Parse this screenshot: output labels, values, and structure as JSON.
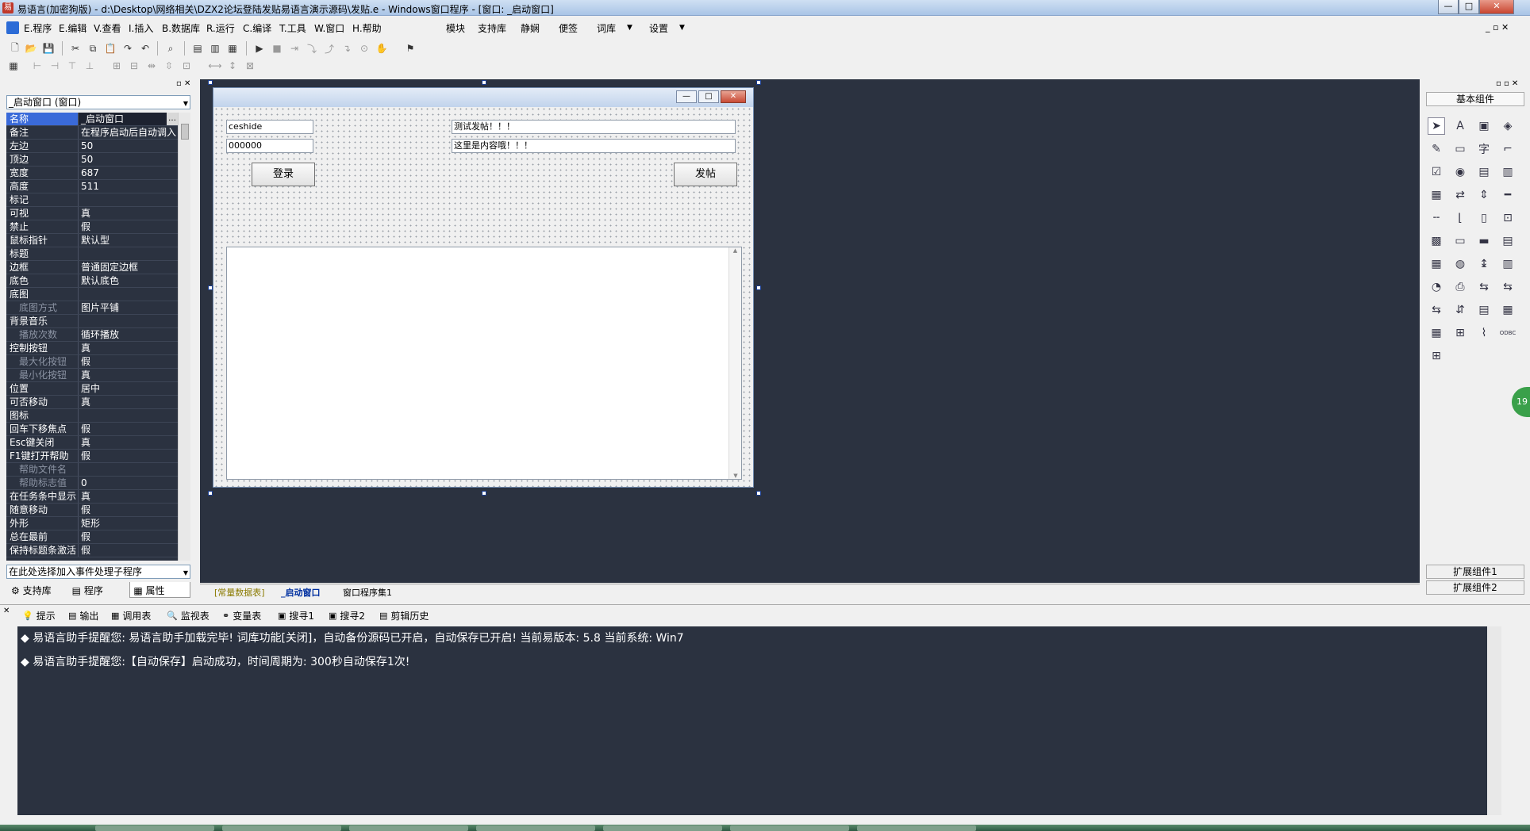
{
  "window": {
    "title": "易语言(加密狗版) - d:\\Desktop\\网络相关\\DZX2论坛登陆发贴易语言演示源码\\发贴.e - Windows窗口程序 - [窗口: _启动窗口]",
    "min": "—",
    "max": "□",
    "close": "✕"
  },
  "menu": {
    "items": [
      "E.程序",
      "E.编辑",
      "V.查看",
      "I.插入",
      "B.数据库",
      "R.运行",
      "C.编译",
      "T.工具",
      "W.窗口",
      "H.帮助"
    ],
    "right_items": [
      "模块",
      "支持库",
      "静娴",
      "便签",
      "词库",
      "设置"
    ]
  },
  "left_panel": {
    "object_combo": "_启动窗口 (窗口)",
    "properties": [
      {
        "k": "名称",
        "v": "_启动窗口",
        "sel": true
      },
      {
        "k": "备注",
        "v": "在程序启动后自动调入"
      },
      {
        "k": "左边",
        "v": "50"
      },
      {
        "k": "顶边",
        "v": "50"
      },
      {
        "k": "宽度",
        "v": "687"
      },
      {
        "k": "高度",
        "v": "511"
      },
      {
        "k": "标记",
        "v": ""
      },
      {
        "k": "可视",
        "v": "真"
      },
      {
        "k": "禁止",
        "v": "假"
      },
      {
        "k": "鼠标指针",
        "v": "默认型"
      },
      {
        "k": "标题",
        "v": ""
      },
      {
        "k": "边框",
        "v": "普通固定边框"
      },
      {
        "k": "底色",
        "v": "默认底色"
      },
      {
        "k": "底图",
        "v": ""
      },
      {
        "k": "底图方式",
        "v": "图片平铺",
        "sub": true
      },
      {
        "k": "背景音乐",
        "v": ""
      },
      {
        "k": "播放次数",
        "v": "循环播放",
        "sub": true
      },
      {
        "k": "控制按钮",
        "v": "真"
      },
      {
        "k": "最大化按钮",
        "v": "假",
        "sub": true
      },
      {
        "k": "最小化按钮",
        "v": "真",
        "sub": true
      },
      {
        "k": "位置",
        "v": "居中"
      },
      {
        "k": "可否移动",
        "v": "真"
      },
      {
        "k": "图标",
        "v": ""
      },
      {
        "k": "回车下移焦点",
        "v": "假"
      },
      {
        "k": "Esc键关闭",
        "v": "真"
      },
      {
        "k": "F1键打开帮助",
        "v": "假"
      },
      {
        "k": "帮助文件名",
        "v": "",
        "sub": true
      },
      {
        "k": "帮助标志值",
        "v": "0",
        "sub": true
      },
      {
        "k": "在任务条中显示",
        "v": "真"
      },
      {
        "k": "随意移动",
        "v": "假"
      },
      {
        "k": "外形",
        "v": "矩形"
      },
      {
        "k": "总在最前",
        "v": "假"
      },
      {
        "k": "保持标题条激活",
        "v": "假"
      }
    ],
    "event_combo": "在此处选择加入事件处理子程序",
    "tabs": [
      "支持库",
      "程序",
      "属性"
    ]
  },
  "design": {
    "input1": "ceshide",
    "input2": "000000",
    "input3": "测试发帖！！！",
    "input4": "这里是内容哦！！！",
    "login_btn": "登录",
    "post_btn": "发帖"
  },
  "editor_tabs": [
    "[常量数据表]",
    "_启动窗口",
    "窗口程序集1"
  ],
  "palette": {
    "title": "基本组件",
    "ext1": "扩展组件1",
    "ext2": "扩展组件2"
  },
  "output_tabs": [
    "提示",
    "输出",
    "调用表",
    "监视表",
    "变量表",
    "搜寻1",
    "搜寻2",
    "剪辑历史"
  ],
  "output": {
    "line1": "易语言助手提醒您:  易语言助手加载完毕!  词库功能[关闭]，自动备份源码已开启，自动保存已开启!  当前易版本: 5.8  当前系统: Win7",
    "line2": "易语言助手提醒您:【自动保存】启动成功，时间周期为: 300秒自动保存1次!"
  },
  "badge": "19"
}
